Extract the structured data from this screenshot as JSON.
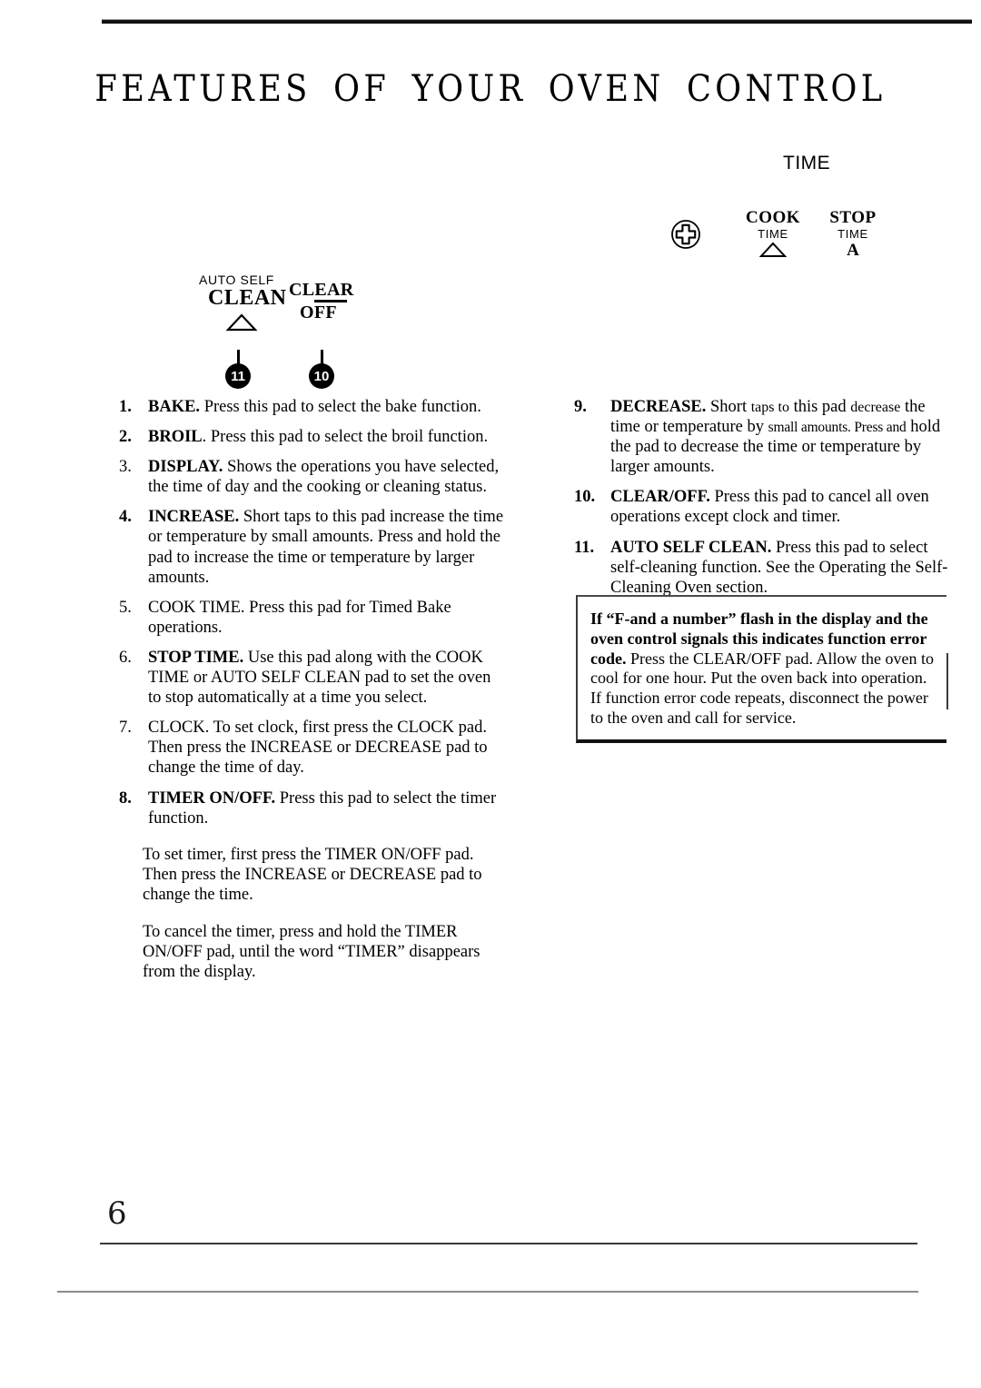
{
  "page": {
    "title": "FEATURES OF YOUR OVEN CONTROL",
    "number": "6"
  },
  "control_panel": {
    "right": {
      "time_heading": "TIME",
      "plus_icon_name": "circled-plus-icon",
      "cook": {
        "main": "COOK",
        "sub": "TIME",
        "mark": "△"
      },
      "stop": {
        "main": "STOP",
        "sub": "TIME",
        "mark": "A"
      }
    },
    "left": {
      "auto_self": "AUTO SELF",
      "clean": "CLEAN",
      "clean_mark": "△",
      "clear": "CLEAR",
      "off": "OFF",
      "callouts": [
        {
          "number": "11"
        },
        {
          "number": "10"
        }
      ]
    }
  },
  "left_column": {
    "items": [
      {
        "num": "1.",
        "num_bold": true,
        "head": "BAKE.",
        "head_bold": true,
        "text": " Press this pad to select the bake function."
      },
      {
        "num": "2.",
        "num_bold": true,
        "head": "BROIL",
        "head_bold": true,
        "text": ". Press this pad to select the broil function."
      },
      {
        "num": "3.",
        "num_bold": false,
        "head": " DISPLAY.",
        "head_bold": true,
        "text": " Shows the operations you have selected, the time of day and the cooking or cleaning  status."
      },
      {
        "num": "4.",
        "num_bold": true,
        "head": "INCREASE.",
        "head_bold": true,
        "text": " Short taps to this pad increase the time or temperature by small amounts. Press and hold the pad to increase the time or temperature by larger amounts."
      },
      {
        "num": "5.",
        "num_bold": false,
        "head": "COOK TIME.",
        "head_bold": false,
        "text": " Press this pad for Timed Bake operations."
      },
      {
        "num": "6.",
        "num_bold": false,
        "head": "STOP TIME.",
        "head_bold": true,
        "text": " Use this pad along with the COOK TIME or AUTO SELF CLEAN pad to set the oven to stop automatically at a time you select."
      },
      {
        "num": "7.",
        "num_bold": false,
        "head": "CLOCK.",
        "head_bold": false,
        "text": " To set clock, first press the CLOCK pad. Then press the INCREASE or DECREASE pad to change the time of day."
      },
      {
        "num": "8.",
        "num_bold": true,
        "head": "TIMER ON/OFF.",
        "head_bold": true,
        "text": " Press this pad to select the timer  function."
      }
    ],
    "paragraphs": [
      "To set timer, first press the TIMER ON/OFF pad. Then press the INCREASE or DECREASE pad to change  the  time.",
      "To cancel the timer, press and hold the TIMER ON/OFF pad, until the word “TIMER” disappears from  the  display."
    ]
  },
  "right_column": {
    "item9": {
      "num": "9.",
      "head": "DECREASE.",
      "seg1": " Short ",
      "seg2": "taps to",
      "seg3": " this ",
      "seg4": "pad ",
      "seg5": "decrease",
      "seg6": " the time or temperature by ",
      "seg7": "small amounts.",
      "seg8": " Press and",
      "seg9": " hold the pad to decrease the time or temperature by  larger  amounts."
    },
    "items": [
      {
        "num": "10.",
        "head": "CLEAR/OFF.",
        "text": " Press this pad to cancel all oven operations except clock and timer."
      },
      {
        "num": "11.",
        "head": "AUTO SELF CLEAN.",
        "text": " Press this pad to select self-cleaning function. See the Operating the Self-Cleaning  Oven  section."
      }
    ],
    "note": {
      "bold": "If “F-and a number” flash in the display and the oven control signals this indicates function error code.",
      "rest": " Press the CLEAR/OFF pad. Allow the oven to cool for one hour. Put the oven back into operation. If function error code repeats, disconnect the power to the oven and call for service."
    }
  }
}
